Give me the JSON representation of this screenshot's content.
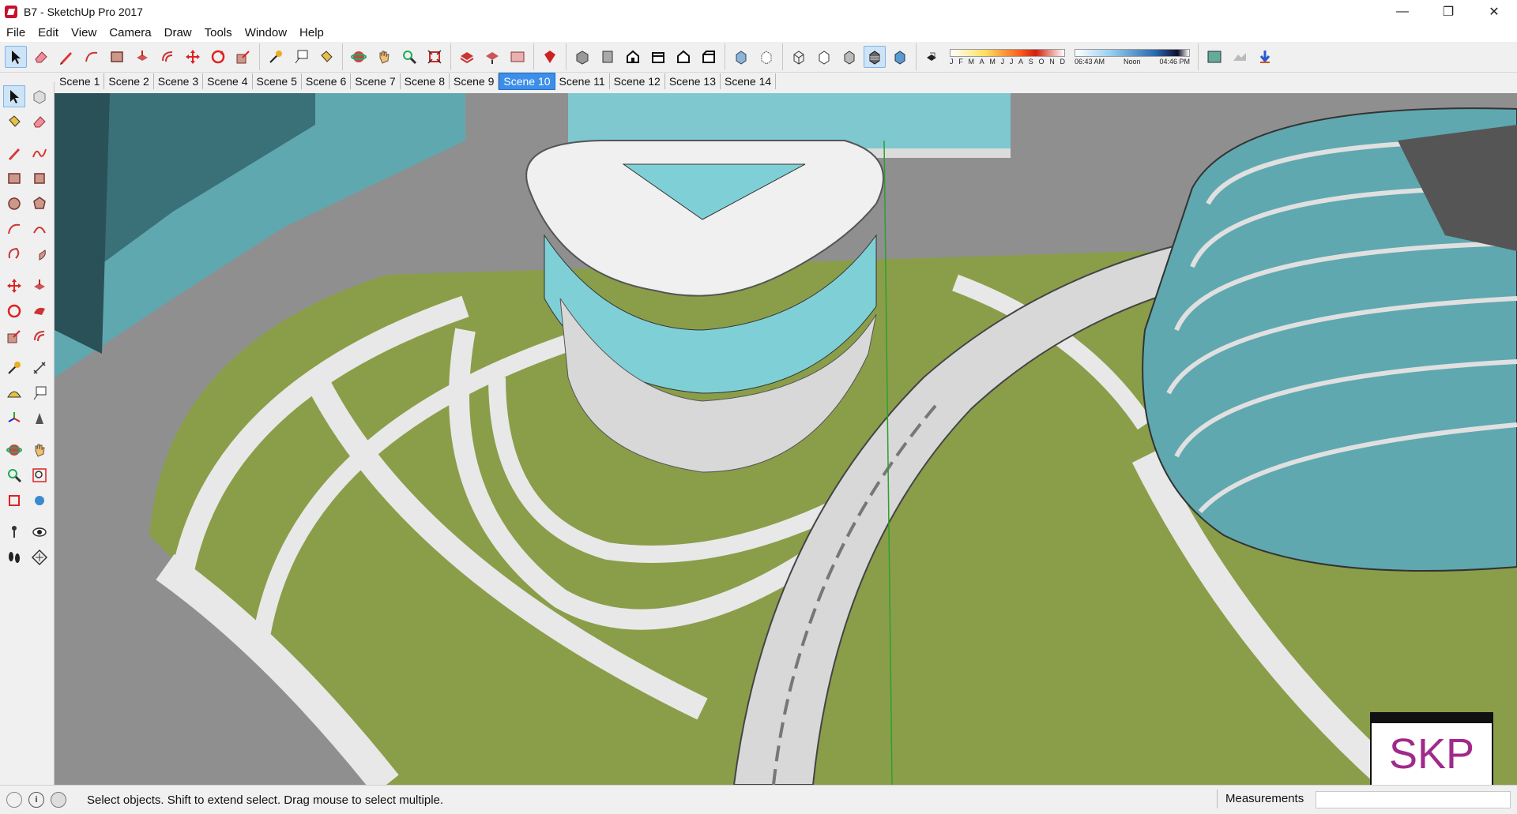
{
  "window": {
    "title": "B7 - SketchUp Pro 2017",
    "controls": {
      "minimize": "—",
      "restore": "❐",
      "close": "✕"
    }
  },
  "menu": [
    "File",
    "Edit",
    "View",
    "Camera",
    "Draw",
    "Tools",
    "Window",
    "Help"
  ],
  "shadow": {
    "months": [
      "J",
      "F",
      "M",
      "A",
      "M",
      "J",
      "J",
      "A",
      "S",
      "O",
      "N",
      "D"
    ],
    "time_start": "06:43 AM",
    "time_mid": "Noon",
    "time_end": "04:46 PM"
  },
  "scenes": {
    "tabs": [
      "Scene 1",
      "Scene 2",
      "Scene 3",
      "Scene 4",
      "Scene 5",
      "Scene 6",
      "Scene 7",
      "Scene 8",
      "Scene 9",
      "Scene 10",
      "Scene 11",
      "Scene 12",
      "Scene 13",
      "Scene 14"
    ],
    "active": "Scene 10"
  },
  "status": {
    "hint": "Select objects. Shift to extend select. Drag mouse to select multiple.",
    "measurements_label": "Measurements",
    "measurements_value": ""
  },
  "badge": {
    "text": "SKP"
  },
  "colors": {
    "lawn": "#8a9e4a",
    "path": "#e8e8e8",
    "glass": "#7fd0d6",
    "road": "#8f8f8f",
    "accent": "#3c8ee8"
  }
}
